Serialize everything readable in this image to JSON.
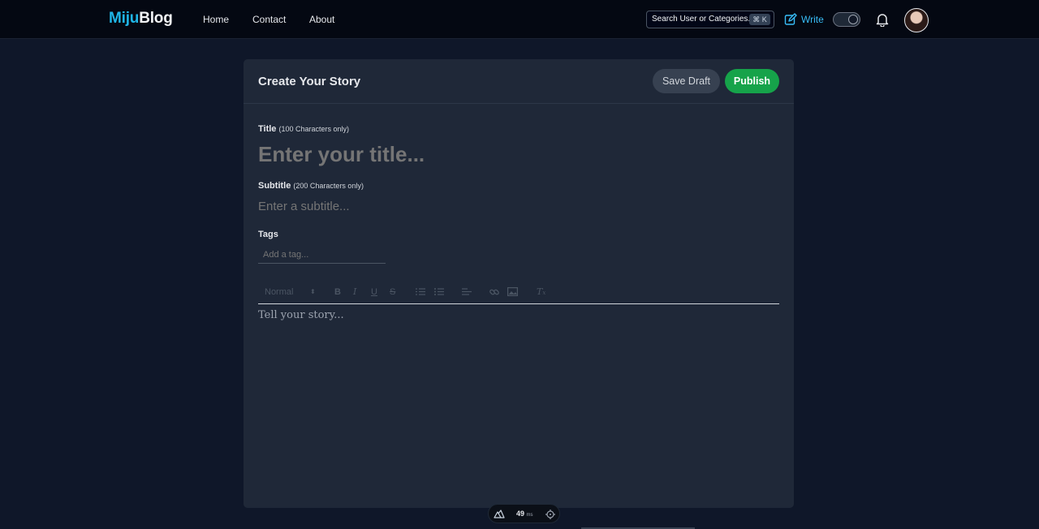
{
  "brand": {
    "part1": "Miju",
    "part2": "Blog"
  },
  "nav": {
    "home": "Home",
    "contact": "Contact",
    "about": "About"
  },
  "search": {
    "text": "Search User or Categories...",
    "shortcut": "⌘ K"
  },
  "write": {
    "label": "Write"
  },
  "editor": {
    "heading": "Create Your Story",
    "save_draft": "Save Draft",
    "publish": "Publish",
    "title_label": "Title",
    "title_hint": "(100 Characters only)",
    "title_placeholder": "Enter your title...",
    "subtitle_label": "Subtitle",
    "subtitle_hint": "(200 Characters only)",
    "subtitle_placeholder": "Enter a subtitle...",
    "tags_label": "Tags",
    "tag_placeholder": "Add a tag...",
    "format_select": "Normal",
    "story_placeholder": "Tell your story..."
  },
  "dev": {
    "time": "49",
    "unit": "ms"
  },
  "colors": {
    "brand_accent": "#1fb5e6",
    "publish": "#16a34a",
    "write": "#38bdf8"
  }
}
